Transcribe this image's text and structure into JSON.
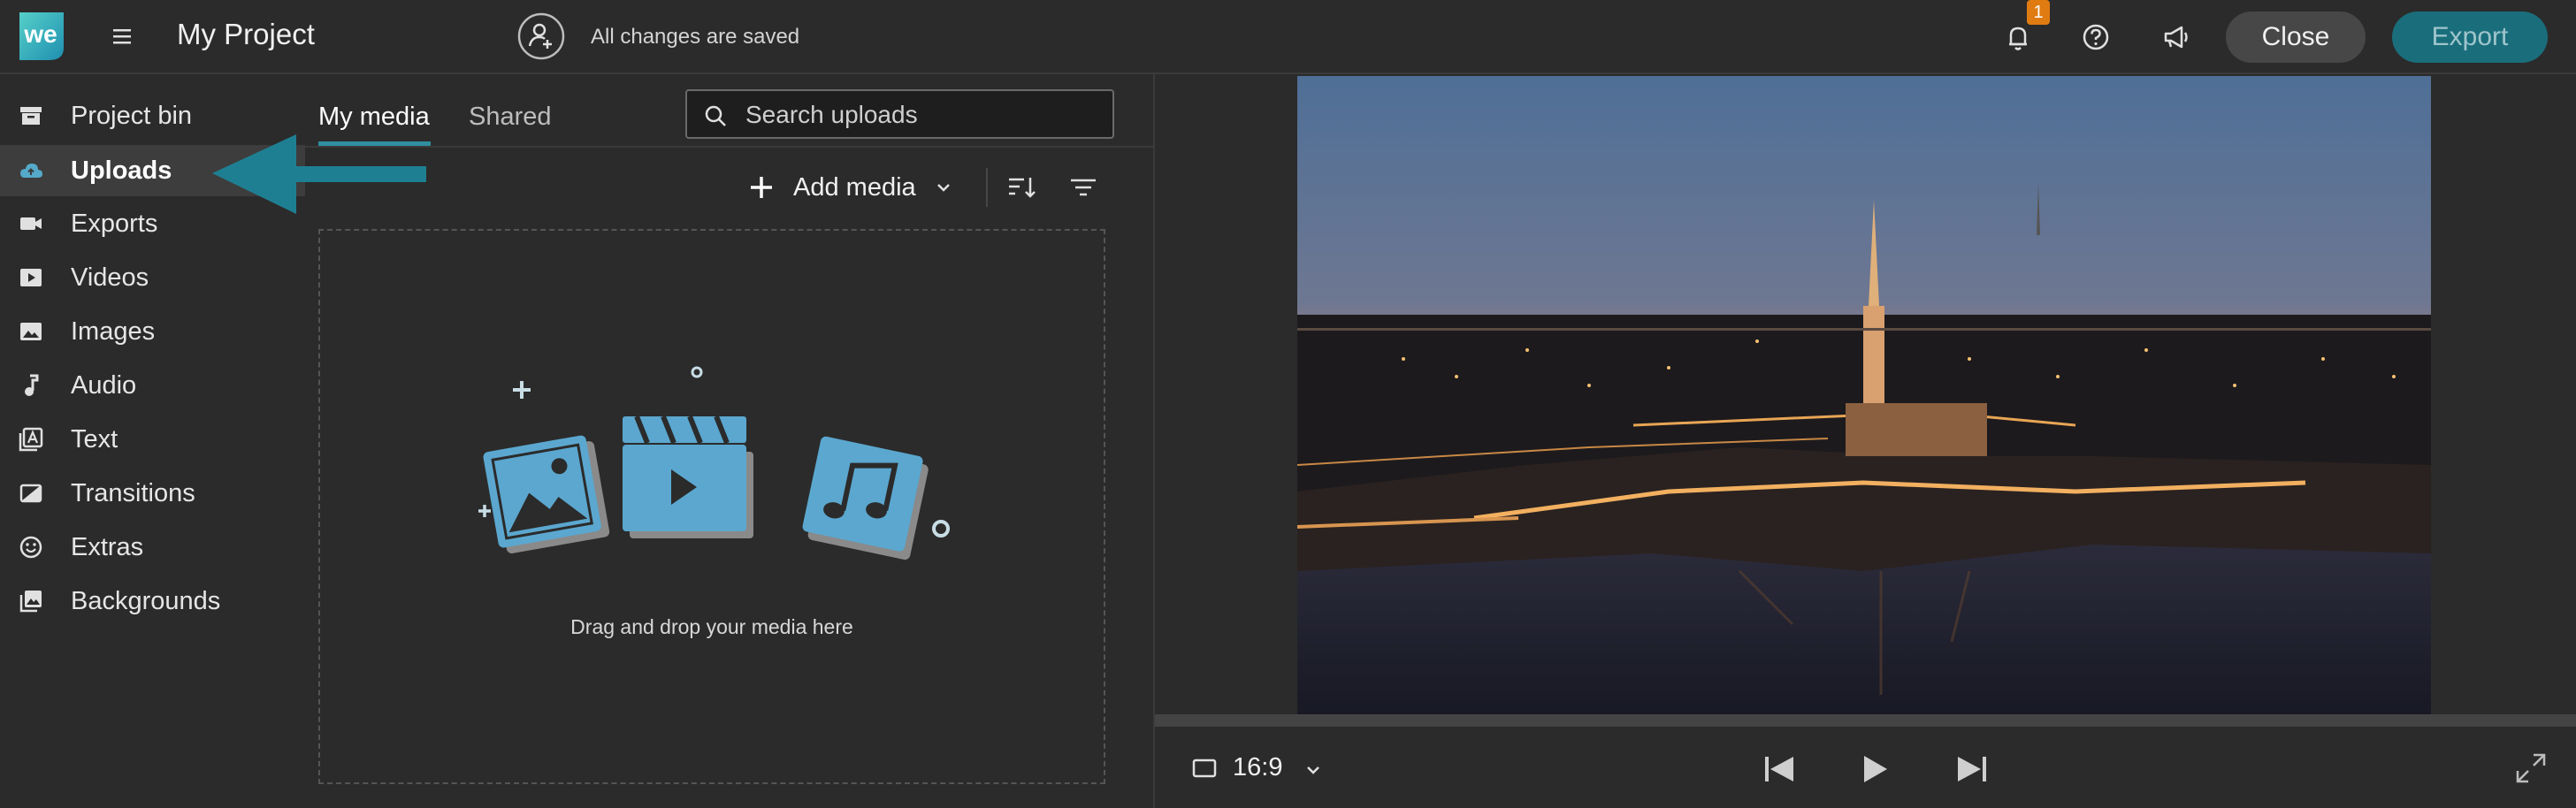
{
  "header": {
    "logo_text": "we",
    "project_title": "My Project",
    "save_status": "All changes are saved",
    "notification_count": "1",
    "close_label": "Close",
    "export_label": "Export"
  },
  "sidebar": {
    "items": [
      {
        "label": "Project bin",
        "icon": "archive-icon"
      },
      {
        "label": "Uploads",
        "icon": "cloud-upload-icon",
        "active": true
      },
      {
        "label": "Exports",
        "icon": "video-camera-icon"
      },
      {
        "label": "Videos",
        "icon": "play-box-icon"
      },
      {
        "label": "Images",
        "icon": "image-icon"
      },
      {
        "label": "Audio",
        "icon": "music-note-icon"
      },
      {
        "label": "Text",
        "icon": "text-icon"
      },
      {
        "label": "Transitions",
        "icon": "transition-icon"
      },
      {
        "label": "Extras",
        "icon": "smiley-icon"
      },
      {
        "label": "Backgrounds",
        "icon": "backgrounds-icon"
      }
    ]
  },
  "media_panel": {
    "tabs": [
      {
        "label": "My media",
        "active": true
      },
      {
        "label": "Shared"
      }
    ],
    "search_placeholder": "Search uploads",
    "add_media_label": "Add media",
    "drop_text": "Drag and drop your media here"
  },
  "player": {
    "aspect_ratio": "16:9"
  },
  "colors": {
    "accent": "#2f8fa0",
    "export_bg": "#1a6e7c",
    "badge": "#e07b12",
    "illustration": "#5ba7cf"
  }
}
